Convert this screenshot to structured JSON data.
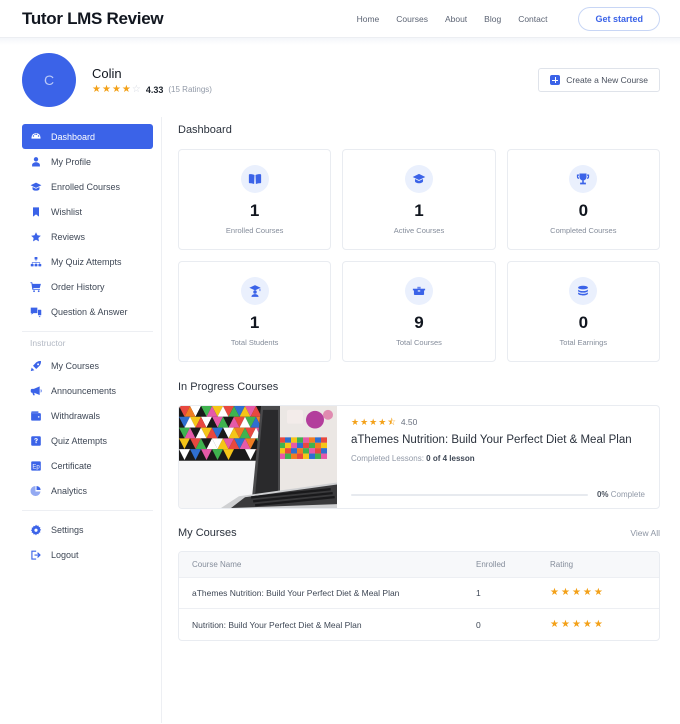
{
  "header": {
    "brand": "Tutor LMS Review",
    "nav": [
      "Home",
      "Courses",
      "About",
      "Blog",
      "Contact"
    ],
    "cta": "Get started",
    "accent": "#3b63e8"
  },
  "profile": {
    "avatar_initial": "C",
    "name": "Colin",
    "rating_value": "4.33",
    "rating_count": "(15 Ratings)",
    "stars_filled": 4,
    "stars_half": 0,
    "stars_empty": 1,
    "create_course_label": "Create a New Course",
    "create_course_icon": "plus-square-icon"
  },
  "sidebar": {
    "items": [
      {
        "label": "Dashboard",
        "icon": "dashboard-icon",
        "active": true
      },
      {
        "label": "My Profile",
        "icon": "user-icon",
        "active": false
      },
      {
        "label": "Enrolled Courses",
        "icon": "graduation-cap-icon",
        "active": false
      },
      {
        "label": "Wishlist",
        "icon": "bookmark-icon",
        "active": false
      },
      {
        "label": "Reviews",
        "icon": "star-icon",
        "active": false
      },
      {
        "label": "My Quiz Attempts",
        "icon": "sitemap-icon",
        "active": false
      },
      {
        "label": "Order History",
        "icon": "cart-icon",
        "active": false
      },
      {
        "label": "Question & Answer",
        "icon": "question-chat-icon",
        "active": false
      }
    ],
    "group_label": "Instructor",
    "instructor_items": [
      {
        "label": "My Courses",
        "icon": "rocket-icon"
      },
      {
        "label": "Announcements",
        "icon": "megaphone-icon"
      },
      {
        "label": "Withdrawals",
        "icon": "wallet-icon"
      },
      {
        "label": "Quiz Attempts",
        "icon": "quiz-icon"
      },
      {
        "label": "Certificate",
        "icon": "certificate-icon"
      },
      {
        "label": "Analytics",
        "icon": "pie-chart-icon"
      }
    ],
    "footer_items": [
      {
        "label": "Settings",
        "icon": "gear-icon"
      },
      {
        "label": "Logout",
        "icon": "logout-icon"
      }
    ]
  },
  "main": {
    "dashboard_title": "Dashboard",
    "stats": [
      {
        "value": "1",
        "label": "Enrolled Courses",
        "icon": "book-icon"
      },
      {
        "value": "1",
        "label": "Active Courses",
        "icon": "graduation-cap-icon"
      },
      {
        "value": "0",
        "label": "Completed Courses",
        "icon": "trophy-icon"
      },
      {
        "value": "1",
        "label": "Total Students",
        "icon": "student-icon"
      },
      {
        "value": "9",
        "label": "Total Courses",
        "icon": "courses-icon"
      },
      {
        "value": "0",
        "label": "Total Earnings",
        "icon": "coins-icon"
      }
    ],
    "in_progress": {
      "section_title": "In Progress Courses",
      "thumbnail_icon": "laptop-photo",
      "rating_value": "4.50",
      "stars_filled": 4,
      "stars_half": 1,
      "stars_empty": 0,
      "title": "aThemes Nutrition: Build Your Perfect Diet & Meal Plan",
      "lessons_label": "Completed Lessons:",
      "lessons_value": "0 of 4 lesson",
      "progress_percent": 0,
      "progress_pct_text": "0%",
      "progress_complete_text": "Complete"
    },
    "my_courses": {
      "section_title": "My Courses",
      "view_all": "View All",
      "columns": [
        "Course Name",
        "Enrolled",
        "Rating"
      ],
      "rows": [
        {
          "name": "aThemes Nutrition: Build Your Perfect Diet & Meal Plan",
          "enrolled": "1",
          "stars": 5
        },
        {
          "name": "Nutrition: Build Your Perfect Diet & Meal Plan",
          "enrolled": "0",
          "stars": 5
        }
      ]
    }
  }
}
